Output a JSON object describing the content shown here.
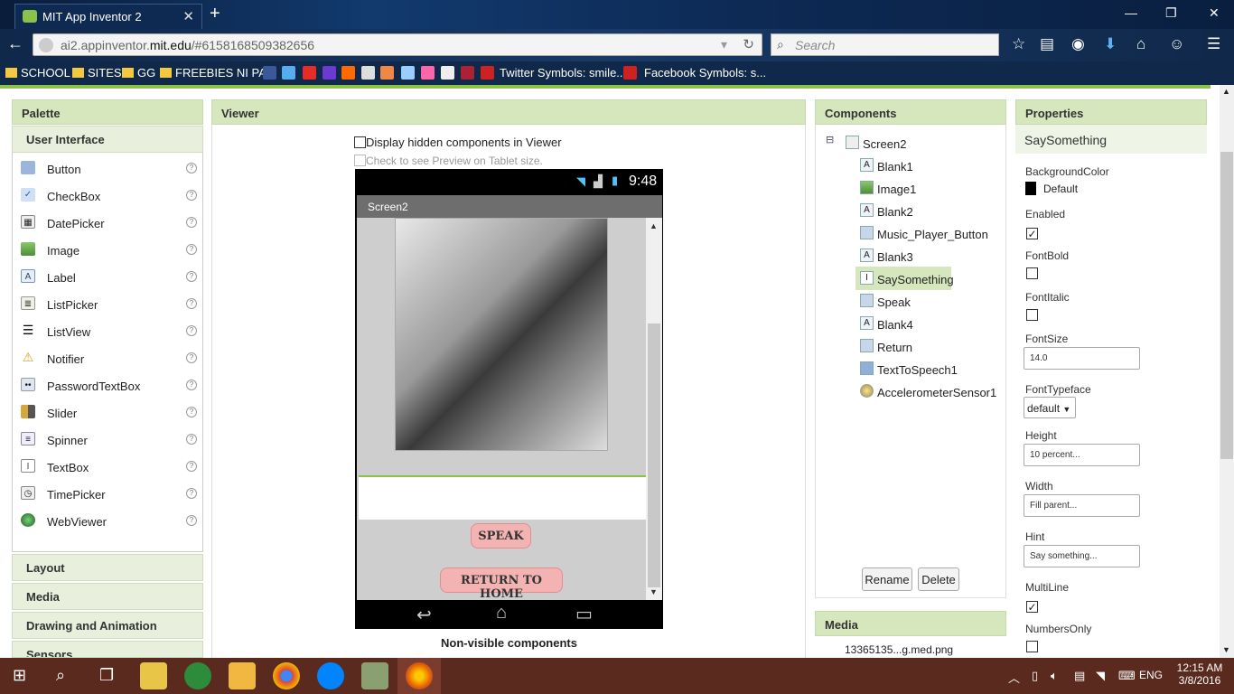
{
  "browser": {
    "tab_title": "MIT App Inventor 2",
    "url_prefix": "ai2.appinventor.",
    "url_domain": "mit.edu",
    "url_suffix": "/#6158168509382656",
    "search_placeholder": "Search",
    "bookmarks": [
      "SCHOOL",
      "SITES",
      "GG",
      "FREEBIES NI PAO",
      "Twitter Symbols: smile...",
      "Facebook Symbols: s..."
    ]
  },
  "palette": {
    "title": "Palette",
    "section_ui": "User Interface",
    "items": [
      {
        "label": "Button",
        "icon": "button-icon"
      },
      {
        "label": "CheckBox",
        "icon": "checkbox-icon"
      },
      {
        "label": "DatePicker",
        "icon": "datepicker-icon"
      },
      {
        "label": "Image",
        "icon": "image-icon"
      },
      {
        "label": "Label",
        "icon": "label-icon"
      },
      {
        "label": "ListPicker",
        "icon": "listpicker-icon"
      },
      {
        "label": "ListView",
        "icon": "listview-icon"
      },
      {
        "label": "Notifier",
        "icon": "notifier-icon"
      },
      {
        "label": "PasswordTextBox",
        "icon": "password-icon"
      },
      {
        "label": "Slider",
        "icon": "slider-icon"
      },
      {
        "label": "Spinner",
        "icon": "spinner-icon"
      },
      {
        "label": "TextBox",
        "icon": "textbox-icon"
      },
      {
        "label": "TimePicker",
        "icon": "timepicker-icon"
      },
      {
        "label": "WebViewer",
        "icon": "webviewer-icon"
      }
    ],
    "sections": [
      "Layout",
      "Media",
      "Drawing and Animation",
      "Sensors"
    ]
  },
  "viewer": {
    "title": "Viewer",
    "hidden_label": "Display hidden components in Viewer",
    "tablet_label": "Check to see Preview on Tablet size.",
    "phone_time": "9:48",
    "screen_title": "Screen2",
    "speak_label": "SPEAK",
    "return_label": "RETURN TO HOME",
    "nonvisible_label": "Non-visible components"
  },
  "components": {
    "title": "Components",
    "root": "Screen2",
    "items": [
      "Blank1",
      "Image1",
      "Blank2",
      "Music_Player_Button",
      "Blank3",
      "SaySomething",
      "Speak",
      "Blank4",
      "Return",
      "TextToSpeech1",
      "AccelerometerSensor1"
    ],
    "selected": "SaySomething",
    "rename_label": "Rename",
    "delete_label": "Delete"
  },
  "media": {
    "title": "Media",
    "file": "13365135...g.med.png"
  },
  "properties": {
    "title": "Properties",
    "component": "SaySomething",
    "background_label": "BackgroundColor",
    "background_value": "Default",
    "enabled_label": "Enabled",
    "fontbold_label": "FontBold",
    "fontitalic_label": "FontItalic",
    "fontsize_label": "FontSize",
    "fontsize_value": "14.0",
    "typeface_label": "FontTypeface",
    "typeface_value": "default",
    "height_label": "Height",
    "height_value": "10 percent...",
    "width_label": "Width",
    "width_value": "Fill parent...",
    "hint_label": "Hint",
    "hint_value": "Say something...",
    "multiline_label": "MultiLine",
    "numbersonly_label": "NumbersOnly"
  },
  "taskbar": {
    "language": "ENG",
    "time": "12:15 AM",
    "date": "3/8/2016"
  },
  "colors": {
    "accent_green": "#8bc34a",
    "panel_header": "#d6e7bd",
    "button_pink": "#f4b3b3"
  }
}
